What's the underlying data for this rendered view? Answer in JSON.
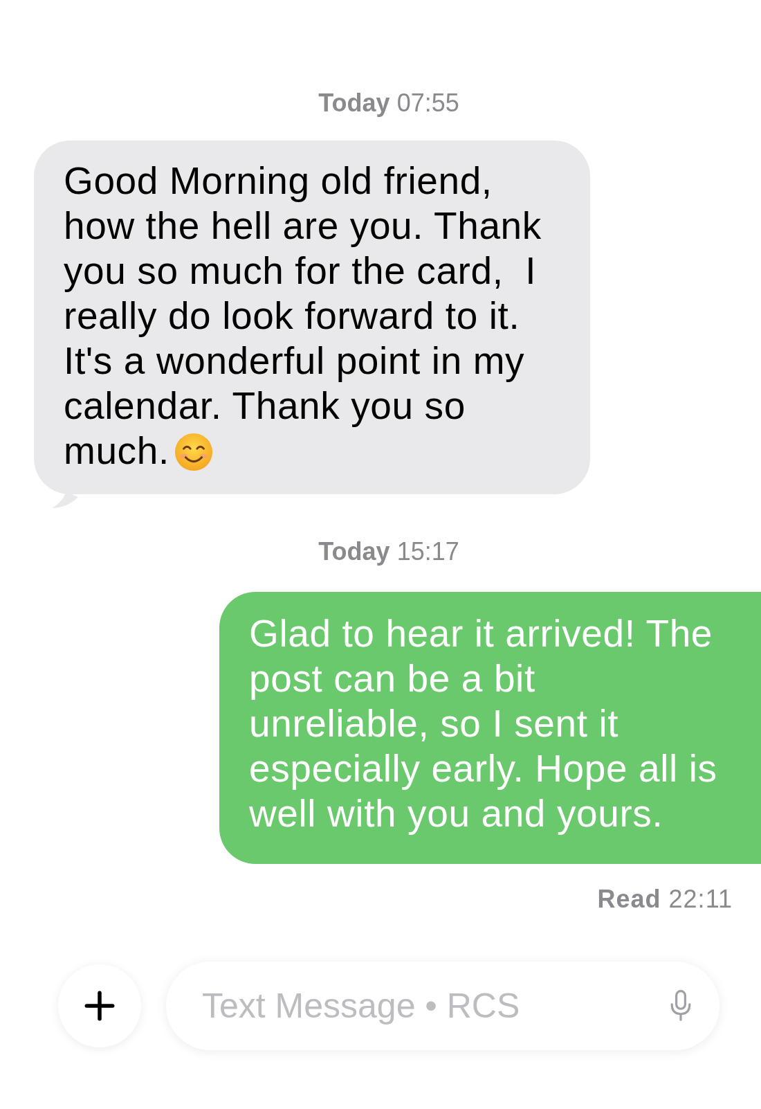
{
  "conversation": [
    {
      "kind": "timestamp",
      "text": "**Today** 07:55"
    },
    {
      "kind": "received",
      "text": "Good Morning old friend, how the hell are you. Thank you so much for the card,  I really do look forward to it. It's a wonderful point in my calendar. Thank you so much.",
      "ends_with_emoji": true
    },
    {
      "kind": "timestamp",
      "text": "**Today** 15:17"
    },
    {
      "kind": "sent",
      "text": "Glad to hear it arrived! The post can be a bit unreliable, so I sent it especially early. Hope all is well with you and yours."
    },
    {
      "kind": "receipt",
      "text": "**Read** 22:11"
    }
  ],
  "composer": {
    "placeholder": "Text Message • RCS"
  }
}
